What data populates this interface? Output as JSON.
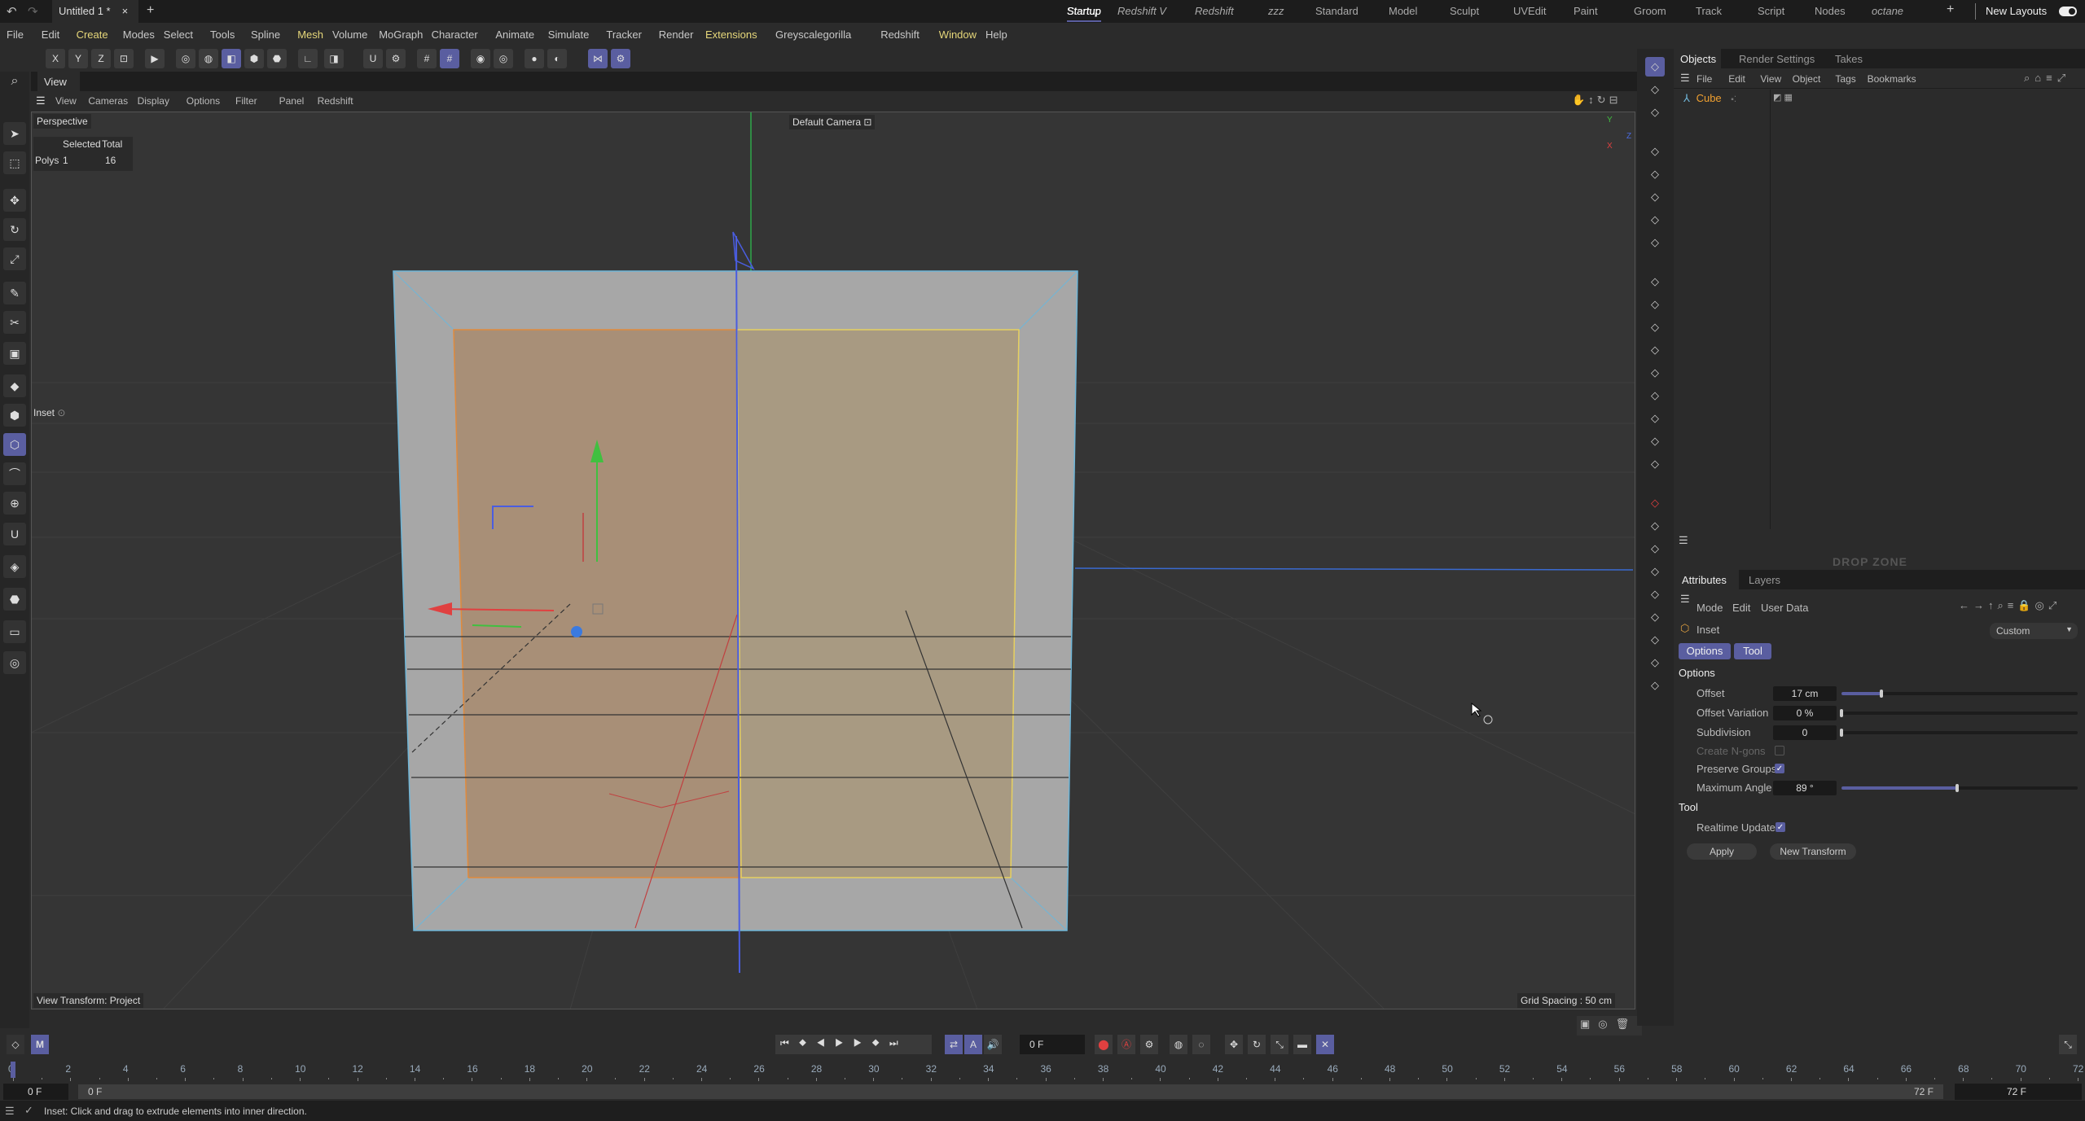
{
  "titlebar": {
    "doc_tab": "Untitled 1 *",
    "close": "×",
    "add": "+",
    "workspaces": [
      "Startup",
      "Redshift V",
      "Redshift",
      "zzz",
      "Standard",
      "Model",
      "Sculpt",
      "UVEdit",
      "Paint",
      "Groom",
      "Track",
      "Script",
      "Nodes",
      "octane"
    ],
    "active_workspace": "Startup",
    "add_layout": "+",
    "new_layouts": "New Layouts"
  },
  "menu": [
    "File",
    "Edit",
    "Create",
    "Modes",
    "Select",
    "Tools",
    "Spline",
    "Mesh",
    "Volume",
    "MoGraph",
    "Character",
    "Animate",
    "Simulate",
    "Tracker",
    "Render",
    "Extensions",
    "Greyscalegorilla",
    "Redshift",
    "Window",
    "Help"
  ],
  "toolbar": {
    "x": "X",
    "y": "Y",
    "z": "Z"
  },
  "view": {
    "tab": "View",
    "menu": [
      "View",
      "Cameras",
      "Display",
      "Options",
      "Filter",
      "Panel",
      "Redshift"
    ],
    "camera_name": "Perspective",
    "default_camera": "Default Camera",
    "stats": {
      "col_selected": "Selected",
      "col_total": "Total",
      "row_label": "Polys",
      "selected": "1",
      "total": "16"
    },
    "tool_label": "Inset",
    "view_transform": "View Transform: Project",
    "grid_spacing": "Grid Spacing : 50 cm",
    "axis": {
      "y": "Y",
      "z": "Z",
      "x": "X"
    }
  },
  "objects": {
    "tabs": [
      "Objects",
      "Render Settings",
      "Takes"
    ],
    "menu": [
      "File",
      "Edit",
      "View",
      "Object",
      "Tags",
      "Bookmarks"
    ],
    "items": [
      {
        "name": "Cube"
      }
    ]
  },
  "dropzone": "DROP ZONE",
  "attributes": {
    "tabs": [
      "Attributes",
      "Layers"
    ],
    "menu": [
      "Mode",
      "Edit",
      "User Data"
    ],
    "tool_name": "Inset",
    "preset": "Custom",
    "subtabs": [
      "Options",
      "Tool"
    ],
    "options_heading": "Options",
    "offset": {
      "label": "Offset",
      "value": "17 cm",
      "slider": 0.17
    },
    "offset_variation": {
      "label": "Offset Variation",
      "value": "0 %",
      "slider": 0
    },
    "subdivision": {
      "label": "Subdivision",
      "value": "0",
      "slider": 0
    },
    "create_ngons": {
      "label": "Create N-gons",
      "checked": false
    },
    "preserve_groups": {
      "label": "Preserve Groups",
      "checked": true
    },
    "maximum_angle": {
      "label": "Maximum Angle",
      "value": "89 °",
      "slider": 0.49
    },
    "tool_heading": "Tool",
    "realtime_update": {
      "label": "Realtime Update",
      "checked": true
    },
    "apply": "Apply",
    "new_transform": "New Transform"
  },
  "timeline": {
    "current_frame": "0 F",
    "start": "0 F",
    "range_start": "0 F",
    "range_end": "72 F",
    "end": "72 F",
    "min": 0,
    "max": 72,
    "step": 2
  },
  "status": "Inset: Click and drag to extrude elements into inner direction.",
  "colors": {
    "accent": "#5a5ea0",
    "x_axis": "#e04040",
    "y_axis": "#40c040",
    "z_axis": "#4060e0",
    "selection_orange": "#e08a3c",
    "selection_yellow": "#e6d060"
  }
}
